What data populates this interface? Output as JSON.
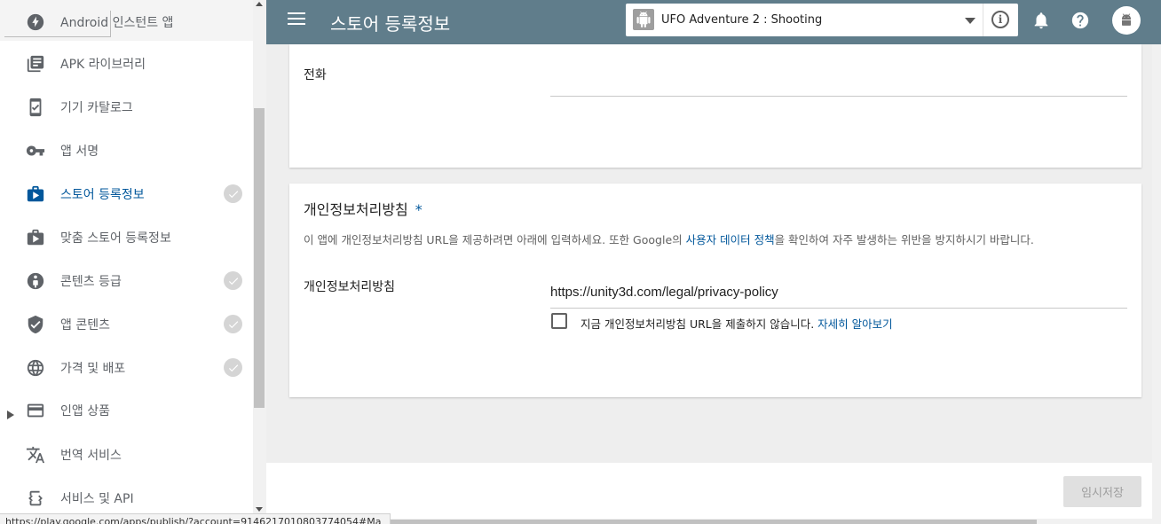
{
  "topbar": {
    "title": "스토어 등록정보",
    "app_name": "UFO Adventure 2 : Shooting",
    "info_glyph": "i"
  },
  "sidebar": {
    "items": [
      {
        "label": "Android 인스턴트 앱",
        "icon": "bolt-icon"
      },
      {
        "label": "APK 라이브러리",
        "icon": "library-icon"
      },
      {
        "label": "기기 카탈로그",
        "icon": "device-catalog-icon"
      },
      {
        "label": "앱 서명",
        "icon": "key-icon"
      },
      {
        "label": "스토어 등록정보",
        "icon": "store-icon",
        "active": true,
        "checked": true
      },
      {
        "label": "맞춤 스토어 등록정보",
        "icon": "custom-store-icon"
      },
      {
        "label": "콘텐츠 등급",
        "icon": "rating-icon",
        "checked": true
      },
      {
        "label": "앱 콘텐츠",
        "icon": "shield-icon",
        "checked": true
      },
      {
        "label": "가격 및 배포",
        "icon": "globe-icon",
        "checked": true
      },
      {
        "label": "인앱 상품",
        "icon": "card-icon",
        "expandable": true
      },
      {
        "label": "번역 서비스",
        "icon": "translate-icon"
      },
      {
        "label": "서비스 및 API",
        "icon": "api-icon"
      }
    ]
  },
  "contact": {
    "phone_label": "전화"
  },
  "privacy": {
    "title": "개인정보처리방침",
    "required_mark": "*",
    "desc_pre": "이 앱에 개인정보처리방침 URL을 제공하려면 아래에 입력하세요. 또한 Google의 ",
    "desc_link": "사용자 데이터 정책",
    "desc_post": "을 확인하여 자주 발생하는 위반을 방지하시기 바랍니다.",
    "field_label": "개인정보처리방침",
    "url_value": "https://unity3d.com/legal/privacy-policy",
    "checkbox_label": "지금 개인정보처리방침 URL을 제출하지 않습니다. ",
    "checkbox_link": "자세히 알아보기"
  },
  "footer": {
    "save_label": "임시저장"
  },
  "status_bar": {
    "url": "https://play.google.com/apps/publish/?account=9146217010803774054#Ma"
  },
  "colors": {
    "topbar": "#607d8b",
    "accent": "#01579b",
    "check": "#d5d5d5"
  }
}
